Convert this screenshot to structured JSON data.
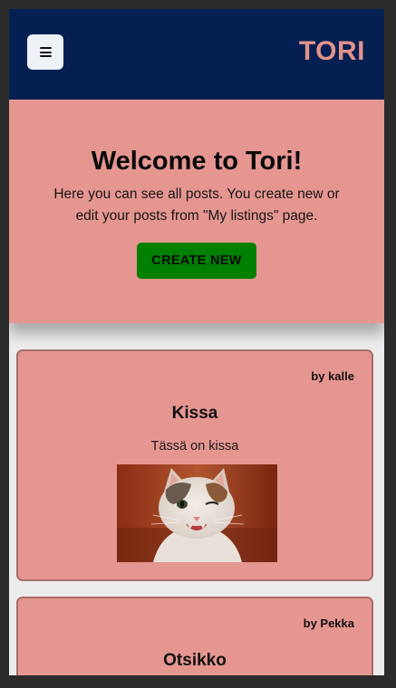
{
  "navbar": {
    "menu_icon": "hamburger-menu-icon",
    "brand": "TORI"
  },
  "hero": {
    "title": "Welcome to Tori!",
    "text": "Here you can see all posts. You create new or edit your posts from \"My listings\" page.",
    "create_label": "CREATE NEW",
    "create_color": "#008000"
  },
  "posts": [
    {
      "author": "by kalle",
      "title": "Kissa",
      "description": "Tässä on kissa",
      "image_icon": "cat-photo"
    },
    {
      "author": "by Pekka",
      "title": "Otsikko"
    }
  ],
  "colors": {
    "navbar": "#041f52",
    "accent": "#e69691",
    "brand": "#e3938b"
  }
}
